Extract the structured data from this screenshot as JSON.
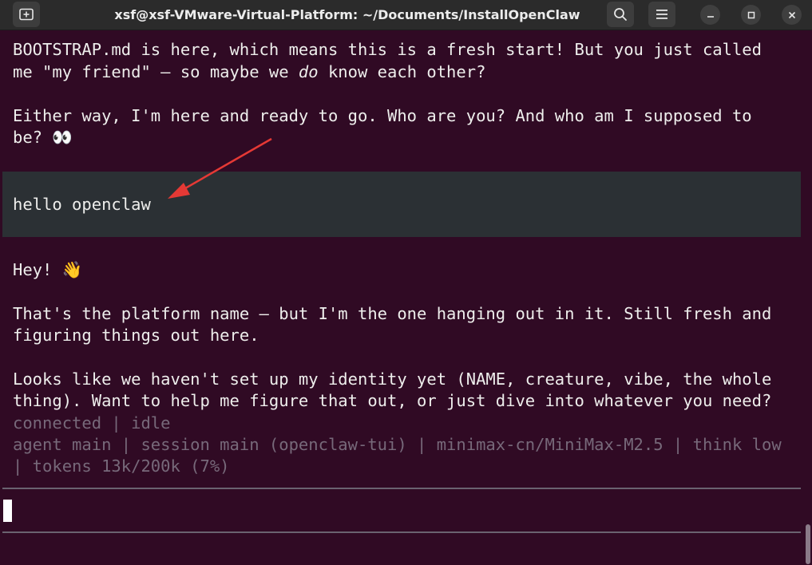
{
  "window": {
    "title": "xsf@xsf-VMware-Virtual-Platform: ~/Documents/InstallOpenClaw"
  },
  "titlebar": {
    "new_tab_icon": "new-tab-icon",
    "search_icon": "search-icon",
    "menu_icon": "hamburger-menu-icon",
    "minimize_icon": "minimize-icon",
    "maximize_icon": "maximize-icon",
    "close_icon": "close-icon"
  },
  "conversation": {
    "assistant_1": {
      "line1": "BOOTSTRAP.md is here, which means this is a fresh start! But you just called",
      "line2_pre": "me \"my friend\" — so maybe we ",
      "line2_em": "do",
      "line2_post": " know each other?",
      "line3": "Either way, I'm here and ready to go. Who are you? And who am I supposed to",
      "line4": "be?",
      "line4_emoji": "👀"
    },
    "user_message": "hello openclaw",
    "assistant_2": {
      "greeting": "Hey!",
      "greeting_emoji": "👋",
      "p1_line1": "That's the platform name — but I'm the one hanging out in it. Still fresh and",
      "p1_line2": "figuring things out here.",
      "p2_line1": "Looks like we haven't set up my identity yet (NAME, creature, vibe, the whole",
      "p2_line2": "thing). Want to help me figure that out, or just dive into whatever you need?"
    }
  },
  "status": {
    "connection": "connected | idle",
    "info_line1": "agent main | session main (openclaw-tui) | minimax-cn/MiniMax-M2.5 | think low",
    "info_line2": "| tokens 13k/200k (7%)"
  },
  "input": {
    "value": ""
  },
  "colors": {
    "terminal_bg": "#300a24",
    "user_block_bg": "#2b3034",
    "annotation_arrow": "#e53935",
    "dim_text": "#77697a"
  }
}
